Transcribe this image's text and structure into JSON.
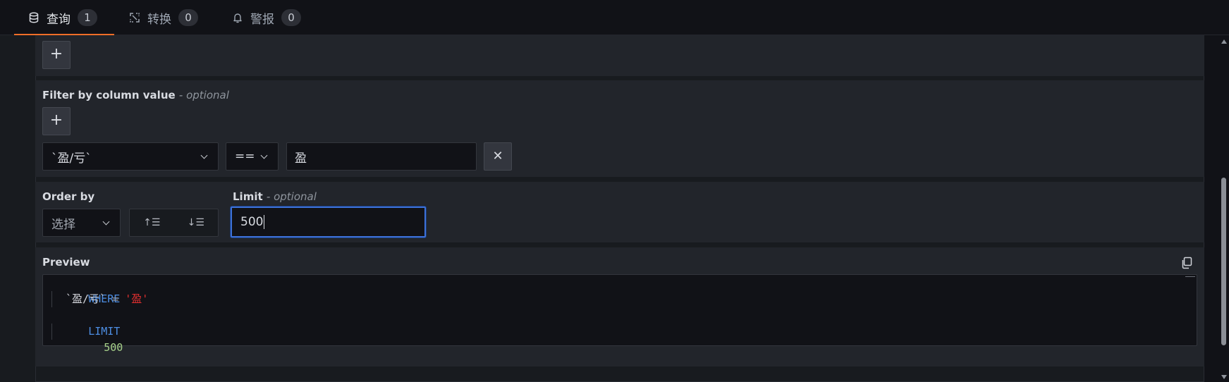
{
  "tabs": [
    {
      "label": "查询",
      "count": "1",
      "icon": "database-icon",
      "active": true
    },
    {
      "label": "转换",
      "count": "0",
      "icon": "transform-icon",
      "active": false
    },
    {
      "label": "警报",
      "count": "0",
      "icon": "bell-icon",
      "active": false
    }
  ],
  "top_section": {
    "add_label": "+"
  },
  "filter": {
    "title": "Filter by column value",
    "optional": "- optional",
    "add_label": "+",
    "column": "`盈/亏`",
    "operator": "==",
    "value": "盈",
    "remove_label": "✕"
  },
  "order": {
    "title": "Order by",
    "select_placeholder": "选择",
    "sort_asc_label": "↑☰",
    "sort_desc_label": "↓☰"
  },
  "limit": {
    "title": "Limit",
    "optional": "- optional",
    "value": "500"
  },
  "preview": {
    "title": "Preview",
    "lines": {
      "where": "WHERE",
      "cond_ident": "`盈/亏`",
      "cond_op": "=",
      "cond_str": "'盈'",
      "limit_kw": "LIMIT",
      "limit_val": "500"
    }
  },
  "colors": {
    "accent_tab": "#ef6e28",
    "focus_border": "#3d71d9",
    "keyword": "#4d8ee3",
    "string": "#e02f2f",
    "number": "#a7d18a"
  }
}
